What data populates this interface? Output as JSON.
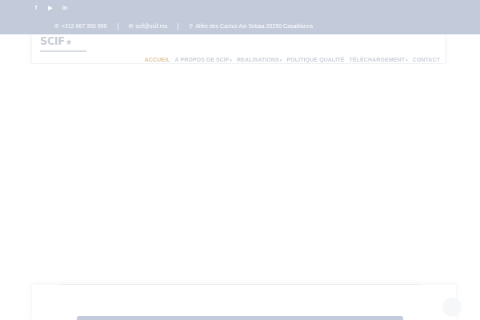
{
  "topbar": {
    "social": [
      {
        "icon": "facebook-icon",
        "glyph": "f"
      },
      {
        "icon": "youtube-icon",
        "glyph": "▶"
      },
      {
        "icon": "linkedin-icon",
        "glyph": "in"
      }
    ],
    "phone": "+212 667 356 999",
    "email": "scif@scif.ma",
    "address": "Allée des Cactus Ain Sebaa 20250 Casablanca"
  },
  "header": {
    "logo_text": "SCIF",
    "nav": [
      {
        "label": "ACCUEIL",
        "active": true
      },
      {
        "label": "A PROPOS DE SCIF",
        "dropdown": true
      },
      {
        "label": "REALISATIONS",
        "dropdown": true
      },
      {
        "label": "POLITIQUE QUALITÉ"
      },
      {
        "label": "TÉLÉCHARGEMENT",
        "dropdown": true
      },
      {
        "label": "CONTACT"
      }
    ]
  },
  "colors": {
    "topbar": "#c3cbdb",
    "accent": "#e1c39a",
    "nav_text": "#c9ced8"
  }
}
